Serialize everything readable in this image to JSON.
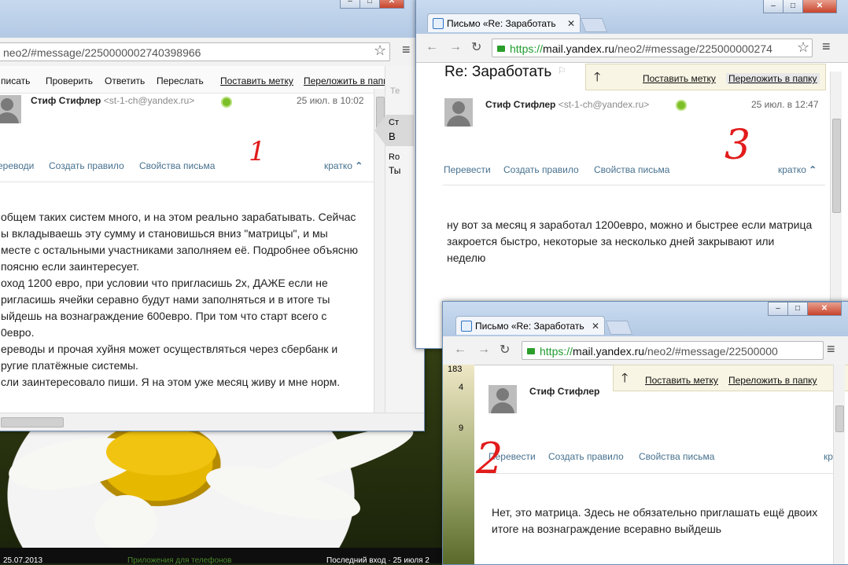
{
  "taskbar": {
    "date": "25.07.2013",
    "apps": "Приложения для телефонов",
    "last_login": "Последний вход · 25 июля 2"
  },
  "win1": {
    "url": "neo2/#message/2250000002740398966",
    "toolbar": [
      "писать",
      "Проверить",
      "Ответить",
      "Переслать",
      "Поставить метку",
      "Переложить в папку"
    ],
    "sender": "Стиф Стифлер",
    "sender_email": "<st-1-ch@yandex.ru>",
    "date": "25 июл. в 10:02",
    "actions": [
      "ереводи",
      "Создать правило",
      "Свойства письма"
    ],
    "brief": "кратко",
    "annotation": "1",
    "body": [
      "общем таких систем много, и на этом реально зарабатывать. Сейчас",
      "ы вкладываешь эту сумму и становишься вниз \"матрицы\", и мы",
      "месте с остальными участниками заполняем её. Подробнее объясню",
      " поясню если заинтересует.",
      "оход 1200 евро, при условии что пригласишь 2х, ДАЖЕ если не",
      "ригласишь ячейки серавно будут нами заполняться и в итоге ты",
      "ыйдешь на вознаграждение 600евро. При том что старт всего с",
      "0евро.",
      "ереводы и прочая хуйня может осуществляться через сбербанк и",
      "ругие платёжные системы.",
      "сли заинтересовало пиши. Я на этом уже месяц живу и мне норм."
    ],
    "side": [
      "Ст",
      "В",
      "Ro",
      "Ты"
    ],
    "side_small": "Те"
  },
  "win3": {
    "tab_title": "Письмо «Re: Заработать",
    "url_https": "https://",
    "url_host": "mail.yandex.ru",
    "url_path": "/neo2/#message/225000000274",
    "subject": "Re: Заработать",
    "toolbar": [
      "Поставить метку",
      "Переложить в папку"
    ],
    "sender": "Стиф Стифлер",
    "sender_email": "<st-1-ch@yandex.ru>",
    "date": "25 июл. в 12:47",
    "actions": [
      "Перевести",
      "Создать правило",
      "Свойства письма"
    ],
    "brief": "кратко",
    "annotation": "3",
    "body": [
      "ну вот за месяц я заработал 1200евро, можно и быстрее если матрица",
      "закроется быстро, некоторые за несколько дней закрывают или",
      "неделю"
    ]
  },
  "win2": {
    "tab_title": "Письмо «Re: Заработать",
    "url_https": "https://",
    "url_host": "mail.yandex.ru",
    "url_path": "/neo2/#message/22500000",
    "toolbar": [
      "Поставить метку",
      "Переложить в папку"
    ],
    "sender": "Стиф Стифлер",
    "sender_email": "<st-1-ch@yandex.ru>",
    "actions": [
      "Перевести",
      "Создать правило",
      "Свойства письма"
    ],
    "brief": "кр",
    "annotation": "2",
    "left_nums": [
      "183",
      "4",
      "9"
    ],
    "body": [
      "Нет, это матрица. Здесь не обязательно приглашать ещё двоих",
      "итоге на вознаграждение всеравно выйдешь"
    ]
  }
}
